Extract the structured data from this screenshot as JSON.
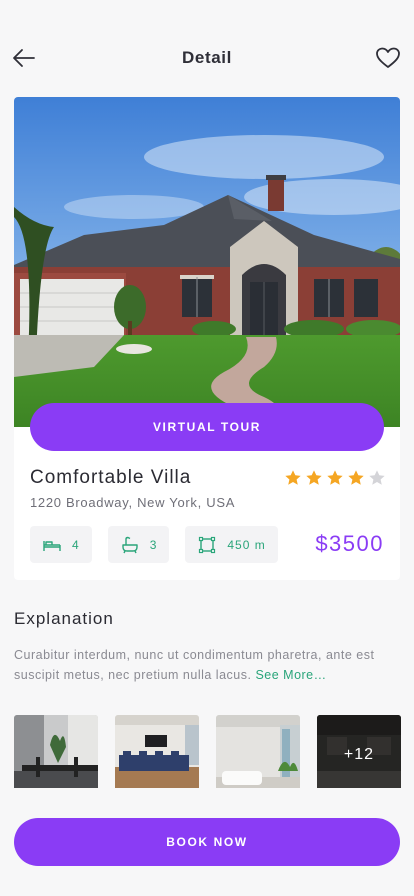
{
  "header": {
    "title": "Detail",
    "back_icon": "arrow-left-icon",
    "favorite_icon": "heart-icon"
  },
  "property": {
    "virtual_tour_label": "VIRTUAL TOUR",
    "name": "Comfortable Villa",
    "address": "1220 Broadway, New York, USA",
    "rating": 4,
    "rating_max": 5,
    "features": [
      {
        "icon": "bed-icon",
        "value": "4"
      },
      {
        "icon": "bathtub-icon",
        "value": "3"
      },
      {
        "icon": "area-icon",
        "value": "450 m"
      }
    ],
    "price": "$3500"
  },
  "explanation": {
    "title": "Explanation",
    "text": "Curabitur interdum, nunc ut condimentum pharetra, ante est suscipit metus, nec pretium nulla lacus. ",
    "see_more": "See More…"
  },
  "gallery": {
    "more_count": "+12"
  },
  "actions": {
    "book_now": "BOOK NOW"
  },
  "colors": {
    "accent": "#8a3cf5",
    "green": "#2aa57a",
    "star": "#f5a623",
    "star_empty": "#d4d4d8"
  }
}
